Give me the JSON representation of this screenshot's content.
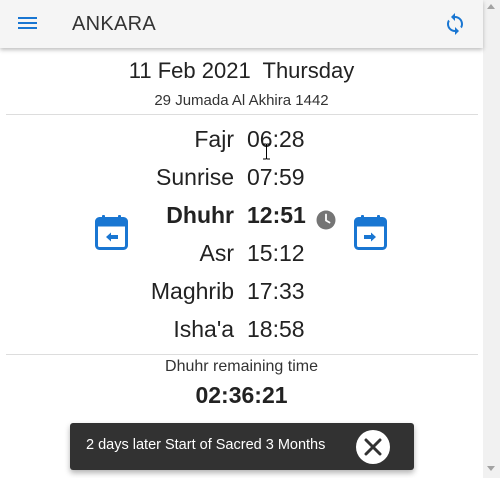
{
  "app": {
    "title": "ANKARA",
    "accent_color": "#1976d2",
    "menu_icon": "hamburger-menu-icon",
    "refresh_icon": "sync-icon"
  },
  "date": {
    "gregorian": "11 Feb 2021  Thursday",
    "hijri": "29 Jumada Al Akhira 1442"
  },
  "prayers": [
    {
      "name": "Fajr",
      "time": "06:28",
      "current": false
    },
    {
      "name": "Sunrise",
      "time": "07:59",
      "current": false
    },
    {
      "name": "Dhuhr",
      "time": "12:51",
      "current": true
    },
    {
      "name": "Asr",
      "time": "15:12",
      "current": false
    },
    {
      "name": "Maghrib",
      "time": "17:33",
      "current": false
    },
    {
      "name": "Isha'a",
      "time": "18:58",
      "current": false
    }
  ],
  "navigation": {
    "prev_icon": "calendar-previous-icon",
    "next_icon": "calendar-next-icon"
  },
  "remaining": {
    "label": "Dhuhr remaining time",
    "value": "02:36:21"
  },
  "snackbar": {
    "message": "2 days later Start of Sacred 3 Months",
    "close_icon": "close-icon"
  }
}
